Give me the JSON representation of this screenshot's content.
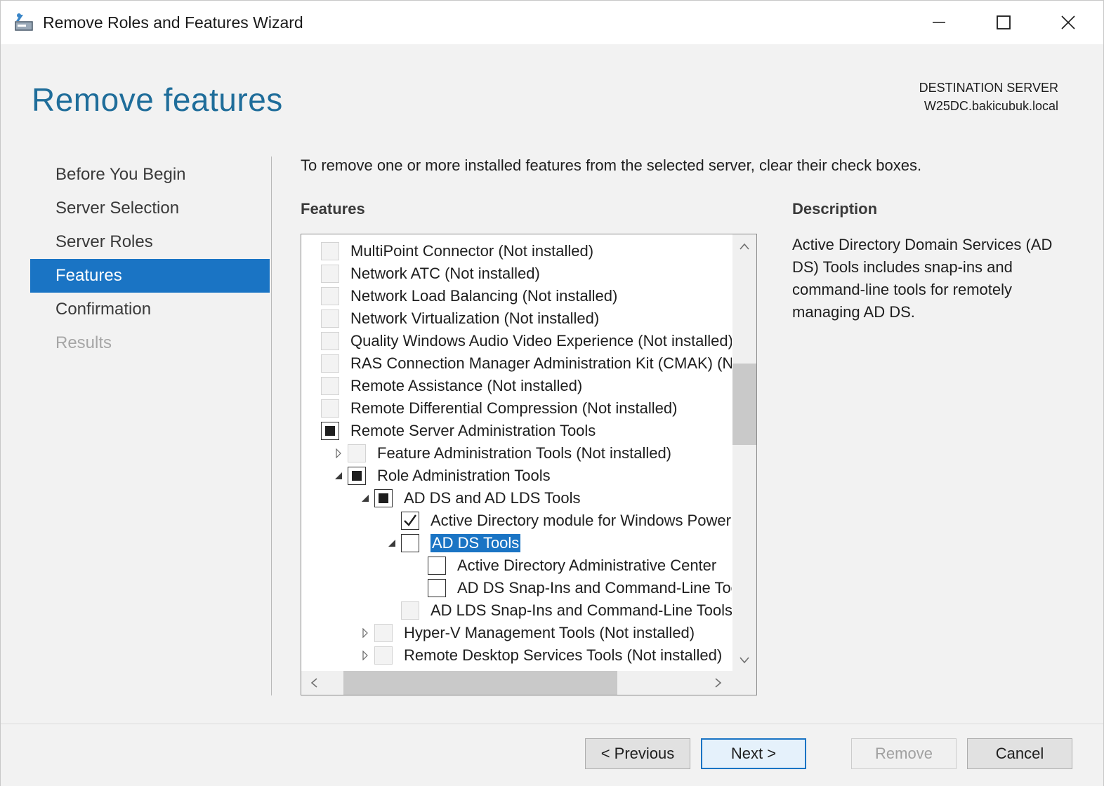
{
  "window": {
    "title": "Remove Roles and Features Wizard"
  },
  "header": {
    "page_title": "Remove features",
    "destination_label": "DESTINATION SERVER",
    "destination_value": "W25DC.bakicubuk.local"
  },
  "nav": {
    "items": [
      {
        "label": "Before You Begin",
        "state": "normal"
      },
      {
        "label": "Server Selection",
        "state": "normal"
      },
      {
        "label": "Server Roles",
        "state": "normal"
      },
      {
        "label": "Features",
        "state": "active"
      },
      {
        "label": "Confirmation",
        "state": "normal"
      },
      {
        "label": "Results",
        "state": "disabled"
      }
    ]
  },
  "main": {
    "instruction": "To remove one or more installed features from the selected server, clear their check boxes.",
    "features_heading": "Features",
    "description_heading": "Description",
    "description_text": "Active Directory Domain Services (AD DS) Tools includes snap-ins and command-line tools for remotely managing AD DS."
  },
  "tree": {
    "items": [
      {
        "label": "MultiPoint Connector (Not installed)",
        "level": 0,
        "expander": "none",
        "check": "disabled"
      },
      {
        "label": "Network ATC (Not installed)",
        "level": 0,
        "expander": "none",
        "check": "disabled"
      },
      {
        "label": "Network Load Balancing (Not installed)",
        "level": 0,
        "expander": "none",
        "check": "disabled"
      },
      {
        "label": "Network Virtualization (Not installed)",
        "level": 0,
        "expander": "none",
        "check": "disabled"
      },
      {
        "label": "Quality Windows Audio Video Experience (Not installed)",
        "level": 0,
        "expander": "none",
        "check": "disabled"
      },
      {
        "label": "RAS Connection Manager Administration Kit (CMAK) (Not installed)",
        "level": 0,
        "expander": "none",
        "check": "disabled"
      },
      {
        "label": "Remote Assistance (Not installed)",
        "level": 0,
        "expander": "none",
        "check": "disabled"
      },
      {
        "label": "Remote Differential Compression (Not installed)",
        "level": 0,
        "expander": "none",
        "check": "disabled"
      },
      {
        "label": "Remote Server Administration Tools",
        "level": 0,
        "expander": "none",
        "check": "indeterminate"
      },
      {
        "label": "Feature Administration Tools (Not installed)",
        "level": 1,
        "expander": "collapsed",
        "check": "disabled"
      },
      {
        "label": "Role Administration Tools",
        "level": 1,
        "expander": "expanded",
        "check": "indeterminate"
      },
      {
        "label": "AD DS and AD LDS Tools",
        "level": 2,
        "expander": "expanded",
        "check": "indeterminate"
      },
      {
        "label": "Active Directory module for Windows PowerShell",
        "level": 3,
        "expander": "none",
        "check": "checked"
      },
      {
        "label": "AD DS Tools",
        "level": 3,
        "expander": "expanded",
        "check": "unchecked",
        "selected": true
      },
      {
        "label": "Active Directory Administrative Center",
        "level": 4,
        "expander": "none",
        "check": "unchecked"
      },
      {
        "label": "AD DS Snap-Ins and Command-Line Tools",
        "level": 4,
        "expander": "none",
        "check": "unchecked"
      },
      {
        "label": "AD LDS Snap-Ins and Command-Line Tools",
        "level": 3,
        "expander": "none",
        "check": "disabled"
      },
      {
        "label": "Hyper-V Management Tools (Not installed)",
        "level": 2,
        "expander": "collapsed",
        "check": "disabled"
      },
      {
        "label": "Remote Desktop Services Tools (Not installed)",
        "level": 2,
        "expander": "collapsed",
        "check": "disabled"
      }
    ]
  },
  "footer": {
    "previous_label": "< Previous",
    "next_label": "Next >",
    "remove_label": "Remove",
    "cancel_label": "Cancel"
  },
  "colors": {
    "accent": "#1a74c4",
    "title_blue": "#1f6d9a",
    "panel_bg": "#f2f2f2"
  }
}
